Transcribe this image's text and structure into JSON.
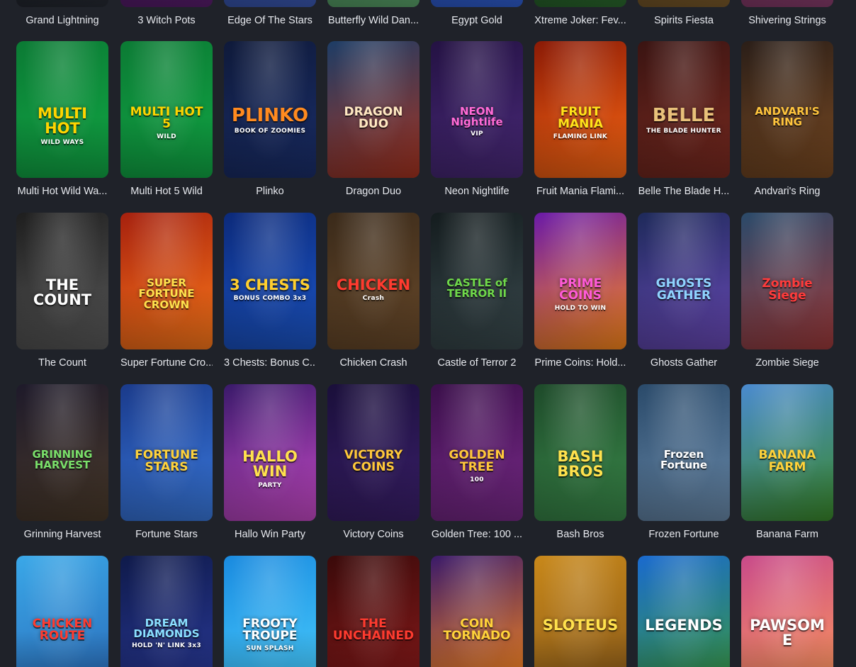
{
  "games": [
    {
      "name": "Grand Lightning",
      "logo": "",
      "sub": "",
      "bg": [
        "#0d0f14",
        "#262a33"
      ],
      "logo_color": "#ffd23f"
    },
    {
      "name": "3 Witch Pots",
      "logo": "",
      "sub": "",
      "bg": [
        "#2a1040",
        "#5a1d6e"
      ],
      "logo_color": "#ffd23f"
    },
    {
      "name": "Edge Of The Stars",
      "logo": "",
      "sub": "",
      "bg": [
        "#1b2f6b",
        "#3b59b3"
      ],
      "logo_color": "#ffffff"
    },
    {
      "name": "Butterfly Wild Dan...",
      "logo": "",
      "sub": "",
      "bg": [
        "#2e5a3a",
        "#5aa36a"
      ],
      "logo_color": "#ffffff"
    },
    {
      "name": "Egypt Gold",
      "logo": "",
      "sub": "",
      "bg": [
        "#1e3a8a",
        "#2f5ed1"
      ],
      "logo_color": "#ffd23f"
    },
    {
      "name": "Xtreme Joker: Fev...",
      "logo": "",
      "sub": "",
      "bg": [
        "#0f2b12",
        "#2b6a2e"
      ],
      "logo_color": "#ffd23f"
    },
    {
      "name": "Spirits Fiesta",
      "logo": "",
      "sub": "",
      "bg": [
        "#3b2a14",
        "#7a5a2a"
      ],
      "logo_color": "#ffd23f"
    },
    {
      "name": "Shivering Strings",
      "logo": "",
      "sub": "",
      "bg": [
        "#4a1f3a",
        "#8a3d6e"
      ],
      "logo_color": "#ffffff"
    },
    {
      "name": "Multi Hot Wild Wa...",
      "logo": "MULTI HOT",
      "sub": "WILD WAYS",
      "bg": [
        "#0b7a34",
        "#11a845"
      ],
      "logo_color": "#ffd400"
    },
    {
      "name": "Multi Hot 5 Wild",
      "logo": "MULTI HOT 5",
      "sub": "WILD",
      "bg": [
        "#0b7a34",
        "#11a845"
      ],
      "logo_color": "#ffd400"
    },
    {
      "name": "Plinko",
      "logo": "PLINKO",
      "sub": "BOOK OF ZOOMIES",
      "bg": [
        "#0f1a3a",
        "#1a2e6a"
      ],
      "logo_color": "#ff8a1f"
    },
    {
      "name": "Dragon Duo",
      "logo": "DRAGON DUO",
      "sub": "",
      "bg": [
        "#1d3d66",
        "#a8331f"
      ],
      "logo_color": "#ffe8c2"
    },
    {
      "name": "Neon Nightlife",
      "logo": "NEON Nightlife",
      "sub": "VIP",
      "bg": [
        "#241243",
        "#4a2a7a"
      ],
      "logo_color": "#ff6ad5"
    },
    {
      "name": "Fruit Mania Flami...",
      "logo": "FRUIT MANIA",
      "sub": "FLAMING LINK",
      "bg": [
        "#8a1a06",
        "#ff6a14"
      ],
      "logo_color": "#ffe31a"
    },
    {
      "name": "Belle The Blade H...",
      "logo": "BELLE",
      "sub": "THE BLADE HUNTER",
      "bg": [
        "#3a1412",
        "#7a2a20"
      ],
      "logo_color": "#e8c17a"
    },
    {
      "name": "Andvari's Ring",
      "logo": "ANDVARI'S RING",
      "sub": "",
      "bg": [
        "#2a1e18",
        "#7a4a22"
      ],
      "logo_color": "#ffc53d"
    },
    {
      "name": "The Count",
      "logo": "THE COUNT",
      "sub": "",
      "bg": [
        "#1e1e1e",
        "#5a5a5a"
      ],
      "logo_color": "#ffffff"
    },
    {
      "name": "Super Fortune Cro...",
      "logo": "SUPER FORTUNE CROWN",
      "sub": "",
      "bg": [
        "#a5200e",
        "#ff7a1a"
      ],
      "logo_color": "#ffe14d"
    },
    {
      "name": "3 Chests: Bonus C...",
      "logo": "3 CHESTS",
      "sub": "BONUS COMBO 3x3",
      "bg": [
        "#0c2a7a",
        "#1c56c8"
      ],
      "logo_color": "#ffcf2e"
    },
    {
      "name": "Chicken Crash",
      "logo": "CHICKEN",
      "sub": "Crash",
      "bg": [
        "#3a2a1a",
        "#6a4a2a"
      ],
      "logo_color": "#ff3b2f"
    },
    {
      "name": "Castle of Terror 2",
      "logo": "CASTLE of TERROR II",
      "sub": "",
      "bg": [
        "#141c1e",
        "#3a4a4e"
      ],
      "logo_color": "#6fd84a"
    },
    {
      "name": "Prime Coins: Hold...",
      "logo": "PRIME COINS",
      "sub": "HOLD TO WIN",
      "bg": [
        "#6a1aa8",
        "#ff8a1a"
      ],
      "logo_color": "#ff5ad8"
    },
    {
      "name": "Ghosts Gather",
      "logo": "GHOSTS GATHER",
      "sub": "",
      "bg": [
        "#1e2a5a",
        "#6a4ab8"
      ],
      "logo_color": "#8fd4ff"
    },
    {
      "name": "Zombie Siege",
      "logo": "Zombie Siege",
      "sub": "",
      "bg": [
        "#2a4a6a",
        "#a03a3a"
      ],
      "logo_color": "#ff3b3b"
    },
    {
      "name": "Grinning Harvest",
      "logo": "GRINNING HARVEST",
      "sub": "",
      "bg": [
        "#1e1a2a",
        "#4a3a2a"
      ],
      "logo_color": "#7adf6a"
    },
    {
      "name": "Fortune Stars",
      "logo": "FORTUNE STARS",
      "sub": "",
      "bg": [
        "#1a3a8a",
        "#3a7adf"
      ],
      "logo_color": "#ffd23a"
    },
    {
      "name": "Hallo Win Party",
      "logo": "HALLO WIN",
      "sub": "PARTY",
      "bg": [
        "#3a1a6a",
        "#c84ac8"
      ],
      "logo_color": "#ffe14d"
    },
    {
      "name": "Victory Coins",
      "logo": "VICTORY COINS",
      "sub": "",
      "bg": [
        "#1a0f3a",
        "#3a1f6a"
      ],
      "logo_color": "#ffc83a"
    },
    {
      "name": "Golden Tree: 100 ...",
      "logo": "GOLDEN TREE",
      "sub": "100",
      "bg": [
        "#3a0f4a",
        "#7a2a8a"
      ],
      "logo_color": "#ffc83a"
    },
    {
      "name": "Bash Bros",
      "logo": "BASH BROS",
      "sub": "",
      "bg": [
        "#1e4a2a",
        "#3a8a4a"
      ],
      "logo_color": "#ffe14d"
    },
    {
      "name": "Frozen Fortune",
      "logo": "Frozen Fortune",
      "sub": "",
      "bg": [
        "#2a4a6a",
        "#6a8aaa"
      ],
      "logo_color": "#ffffff"
    },
    {
      "name": "Banana Farm",
      "logo": "BANANA FARM",
      "sub": "",
      "bg": [
        "#4a8acf",
        "#3a8a2a"
      ],
      "logo_color": "#ffd23a"
    },
    {
      "name": "",
      "logo": "CHICKEN ROUTE",
      "sub": "",
      "bg": [
        "#3aa8e8",
        "#2a6ab8"
      ],
      "logo_color": "#ff3b2f"
    },
    {
      "name": "",
      "logo": "DREAM DIAMONDS",
      "sub": "HOLD 'N' LINK 3x3",
      "bg": [
        "#0f1a4a",
        "#2a3a9a"
      ],
      "logo_color": "#8adfff"
    },
    {
      "name": "",
      "logo": "FROOTY TROUPE",
      "sub": "SUN SPLASH",
      "bg": [
        "#1a8adf",
        "#4acfff"
      ],
      "logo_color": "#ffffff"
    },
    {
      "name": "",
      "logo": "THE UNCHAINED",
      "sub": "",
      "bg": [
        "#3a0a0a",
        "#8a1a1a"
      ],
      "logo_color": "#ff3b2f"
    },
    {
      "name": "",
      "logo": "COIN TORNADO",
      "sub": "",
      "bg": [
        "#3a1a6a",
        "#ff8a1a"
      ],
      "logo_color": "#ffd23a"
    },
    {
      "name": "",
      "logo": "SLOTEUS",
      "sub": "",
      "bg": [
        "#c8881a",
        "#8a5a1a"
      ],
      "logo_color": "#ffe14d"
    },
    {
      "name": "",
      "logo": "LEGENDS",
      "sub": "",
      "bg": [
        "#1a6acf",
        "#3a9a3a"
      ],
      "logo_color": "#ffffff"
    },
    {
      "name": "",
      "logo": "PAWSOME",
      "sub": "",
      "bg": [
        "#c84a8a",
        "#ff9a5a"
      ],
      "logo_color": "#ffffff"
    }
  ]
}
